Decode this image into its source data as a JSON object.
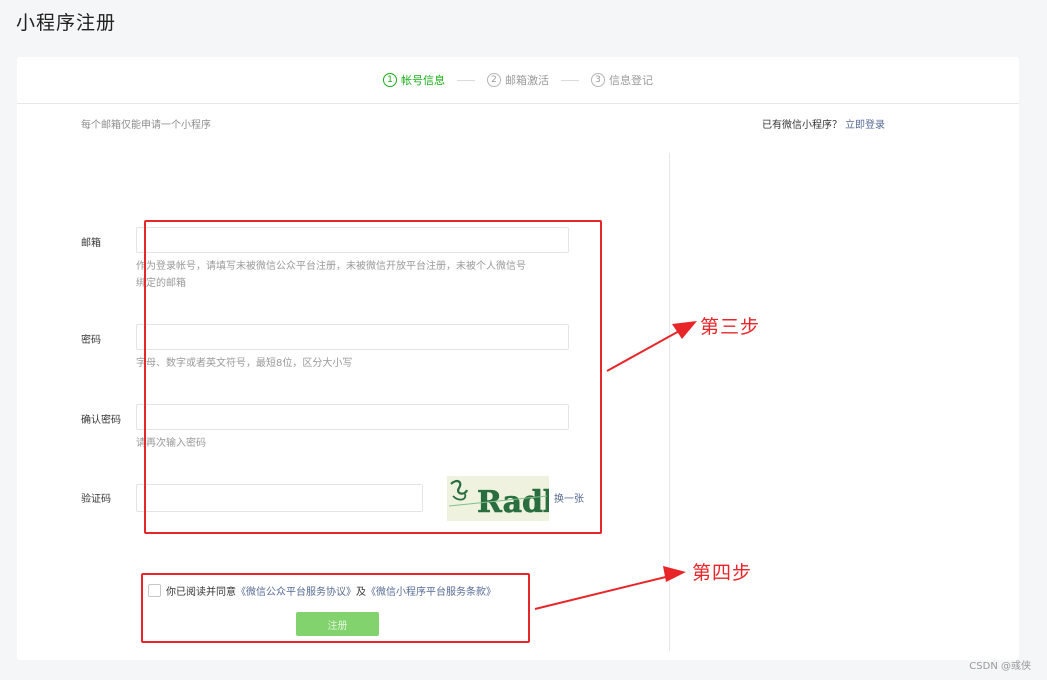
{
  "page": {
    "title": "小程序注册"
  },
  "steps": [
    {
      "num": "1",
      "label": "帐号信息",
      "active": true
    },
    {
      "num": "2",
      "label": "邮箱激活",
      "active": false
    },
    {
      "num": "3",
      "label": "信息登记",
      "active": false
    }
  ],
  "form": {
    "tip": "每个邮箱仅能申请一个小程序",
    "email": {
      "label": "邮箱",
      "value": "",
      "hint_line1": "作为登录帐号，请填写未被微信公众平台注册，未被微信开放平台注册，未被个人微信号",
      "hint_line2": "绑定的邮箱"
    },
    "password": {
      "label": "密码",
      "value": "",
      "hint": "字母、数字或者英文符号，最短8位，区分大小写"
    },
    "confirm": {
      "label": "确认密码",
      "value": "",
      "hint": "请再次输入密码"
    },
    "captcha": {
      "label": "验证码",
      "value": "",
      "image_text": "Radbo",
      "refresh": "换一张"
    },
    "agreement": {
      "prefix": "你已阅读并同意",
      "link1": "《微信公众平台服务协议》",
      "and": "及",
      "link2": "《微信小程序平台服务条款》"
    },
    "submit": "注册"
  },
  "login": {
    "text": "已有微信小程序？",
    "link": "立即登录"
  },
  "annotations": {
    "step3": "第三步",
    "step4": "第四步"
  },
  "watermark": "CSDN @彧侠",
  "colors": {
    "accent": "#1aad19",
    "link": "#576b95",
    "annotation": "#e8262a",
    "button": "#82d36d"
  }
}
